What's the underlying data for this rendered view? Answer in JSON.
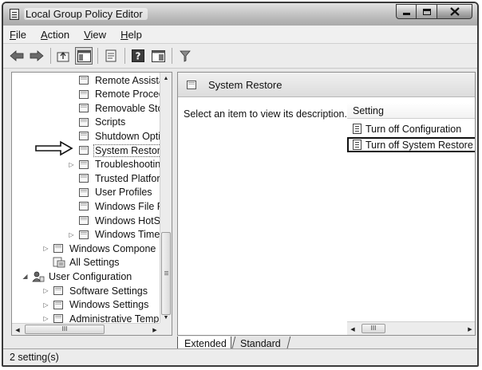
{
  "window": {
    "title": "Local Group Policy Editor"
  },
  "menu": [
    "File",
    "Action",
    "View",
    "Help"
  ],
  "menu_underline_first": true,
  "toolbar": {
    "icons": [
      "back-icon",
      "forward-icon",
      "up-folder-icon",
      "show-hide-tree-icon",
      "export-list-icon",
      "help-icon",
      "properties-icon",
      "filter-icon"
    ]
  },
  "tree": {
    "items": [
      {
        "label": "Remote Assistai",
        "level": 2,
        "expander": false
      },
      {
        "label": "Remote Proced",
        "level": 2,
        "expander": false
      },
      {
        "label": "Removable Stor",
        "level": 2,
        "expander": false
      },
      {
        "label": "Scripts",
        "level": 2,
        "expander": false
      },
      {
        "label": "Shutdown Optic",
        "level": 2,
        "expander": false
      },
      {
        "label": "System Restore",
        "level": 2,
        "expander": false,
        "selected": true
      },
      {
        "label": "Troubleshootin",
        "level": 2,
        "expander": true
      },
      {
        "label": "Trusted Platforr",
        "level": 2,
        "expander": false
      },
      {
        "label": "User Profiles",
        "level": 2,
        "expander": false
      },
      {
        "label": "Windows File Pi",
        "level": 2,
        "expander": false
      },
      {
        "label": "Windows HotSt",
        "level": 2,
        "expander": false
      },
      {
        "label": "Windows Time",
        "level": 2,
        "expander": true
      },
      {
        "label": "Windows Compone",
        "level": 1,
        "expander": true
      },
      {
        "label": "All Settings",
        "level": 1,
        "expander": false,
        "icon": "all-settings-icon"
      },
      {
        "label": "User Configuration",
        "level": 0,
        "expander": "open",
        "icon": "user-config-icon"
      },
      {
        "label": "Software Settings",
        "level": 1,
        "expander": true
      },
      {
        "label": "Windows Settings",
        "level": 1,
        "expander": true
      },
      {
        "label": "Administrative Templa",
        "level": 1,
        "expander": true
      }
    ],
    "hscroll_thumb": "III"
  },
  "right_pane": {
    "header": "System Restore",
    "description": "Select an item to view its description.",
    "column_header": "Setting",
    "settings": [
      {
        "label": "Turn off Configuration",
        "highlighted": false
      },
      {
        "label": "Turn off System Restore",
        "highlighted": true
      }
    ],
    "hscroll_thumb": "III"
  },
  "tabs": {
    "extended": "Extended",
    "standard": "Standard"
  },
  "status": {
    "text": "2 setting(s)"
  }
}
